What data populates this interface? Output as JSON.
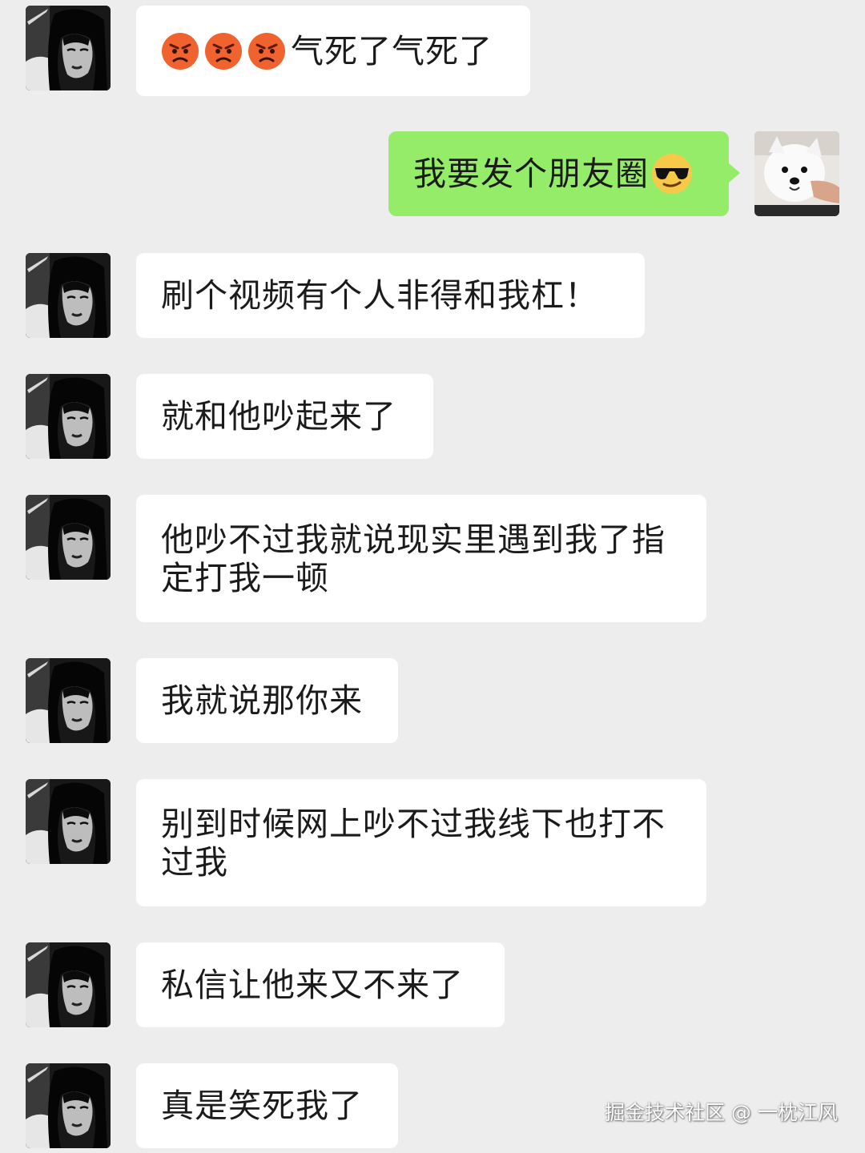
{
  "messages": [
    {
      "side": "in",
      "text": "气死了气死了",
      "emoji_prefix": [
        "angry-face",
        "angry-face",
        "angry-face"
      ]
    },
    {
      "side": "out",
      "text": "我要发个朋友圈",
      "emoji_suffix": "sunglasses-face"
    },
    {
      "side": "in",
      "text": "刷个视频有个人非得和我杠！"
    },
    {
      "side": "in",
      "text": "就和他吵起来了"
    },
    {
      "side": "in",
      "text": "他吵不过我就说现实里遇到我了指定打我一顿"
    },
    {
      "side": "in",
      "text": "我就说那你来"
    },
    {
      "side": "in",
      "text": "别到时候网上吵不过我线下也打不过我"
    },
    {
      "side": "in",
      "text": "私信让他来又不来了"
    },
    {
      "side": "in",
      "text": "真是笑死我了"
    }
  ],
  "watermark": "掘金技术社区 @ 一枕江风",
  "colors": {
    "background": "#ededed",
    "incoming_bubble": "#ffffff",
    "outgoing_bubble": "#95ec69",
    "text": "#1b1b1b"
  }
}
